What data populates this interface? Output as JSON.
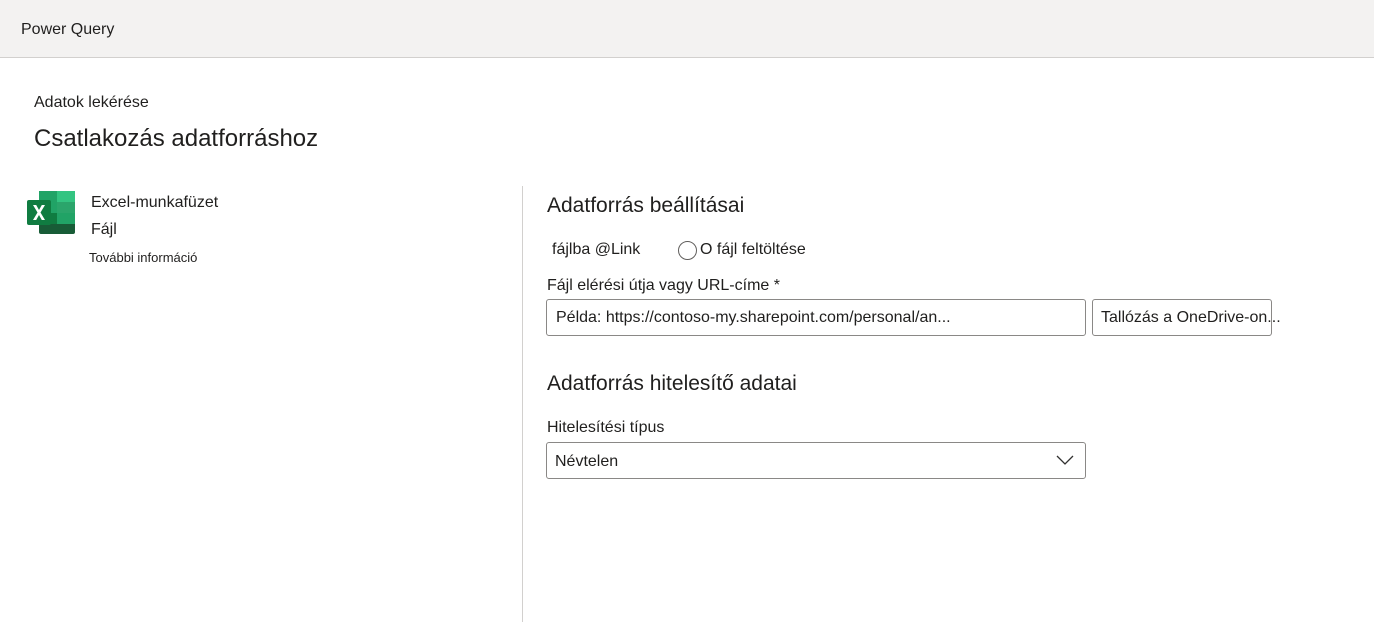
{
  "window": {
    "title": "Power Query"
  },
  "header": {
    "breadcrumb": "Adatok lekérése",
    "title": "Csatlakozás adatforráshoz"
  },
  "connector": {
    "icon": "excel-icon",
    "name": "Excel-munkafüzet",
    "category": "Fájl",
    "more_info": "További információ",
    "colors": {
      "dark": "#185c37",
      "mid": "#21a366",
      "light": "#33c481",
      "badge": "#107c41"
    }
  },
  "settings": {
    "title": "Adatforrás beállításai",
    "link_option": "fájlba @Link",
    "upload_option": "O fájl feltöltése",
    "path_label": "Fájl elérési útja vagy URL-címe *",
    "path_value": "",
    "path_placeholder": "Példa: https://contoso-my.sharepoint.com/personal/an...",
    "browse_label": "Tallózás a OneDrive-on..."
  },
  "credentials": {
    "title": "Adatforrás hitelesítő adatai",
    "auth_label": "Hitelesítési típus",
    "auth_value": "Névtelen"
  }
}
